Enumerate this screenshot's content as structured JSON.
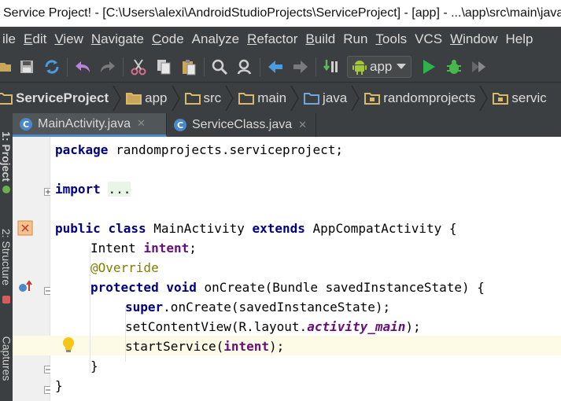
{
  "window": {
    "title": "Service Project! - [C:\\Users\\alexi\\AndroidStudioProjects\\ServiceProject] - [app] - ...\\app\\src\\main\\java\\randomprojects\\serviceproject\\MainActivity.java - Android Studio"
  },
  "menu": {
    "items": [
      "ile",
      "Edit",
      "View",
      "Navigate",
      "Code",
      "Analyze",
      "Refactor",
      "Build",
      "Run",
      "Tools",
      "VCS",
      "Window",
      "Help"
    ],
    "underline_first": [
      false,
      true,
      true,
      true,
      true,
      false,
      true,
      true,
      false,
      true,
      false,
      true,
      false
    ]
  },
  "toolbar": {
    "run_config": "app",
    "icons": [
      "open-icon",
      "save-icon",
      "sync-icon",
      "undo-icon",
      "redo-icon",
      "cut-icon",
      "copy-icon",
      "paste-icon",
      "find-icon",
      "replace-icon",
      "back-icon",
      "forward-icon",
      "make-icon",
      "android-icon",
      "run-icon",
      "debug-icon",
      "profile-icon"
    ],
    "colors": {
      "run": "#2fb24a",
      "debug": "#49b84a",
      "undo": "#b785d8",
      "android": "#a4c639"
    }
  },
  "breadcrumbs": [
    "ServiceProject",
    "app",
    "src",
    "main",
    "java",
    "randomprojects",
    "servic"
  ],
  "left_strip": {
    "project_tab": "1: Project",
    "structure_tab": "2: Structure",
    "captures_tab": "Captures"
  },
  "tabs": [
    {
      "label": "MainActivity.java",
      "active": true
    },
    {
      "label": "ServiceClass.java",
      "active": false
    }
  ],
  "code": {
    "l1": {
      "kw": "package",
      "rest": " randomprojects.serviceproject;"
    },
    "l3": {
      "kw": "import",
      "folded": "..."
    },
    "l5": {
      "kw1": "public",
      "kw2": "class",
      "name": " MainActivity ",
      "kw3": "extends",
      "rest": " AppCompatActivity {"
    },
    "l6": {
      "type": "Intent ",
      "field": "intent",
      "end": ";"
    },
    "l7": {
      "annotation": "@Override"
    },
    "l8": {
      "kw1": "protected",
      "kw2": "void",
      "rest": " onCreate(Bundle savedInstanceState) {"
    },
    "l9": {
      "kw": "super",
      "rest": ".onCreate(savedInstanceState);"
    },
    "l10": {
      "pre": "setContentView(R.layout.",
      "field": "activity_main",
      "end": ");"
    },
    "l11": {
      "pre": "startService(",
      "field": "intent",
      "end": ");"
    },
    "l12": {
      "text": "}"
    },
    "l13": {
      "text": "}"
    }
  }
}
